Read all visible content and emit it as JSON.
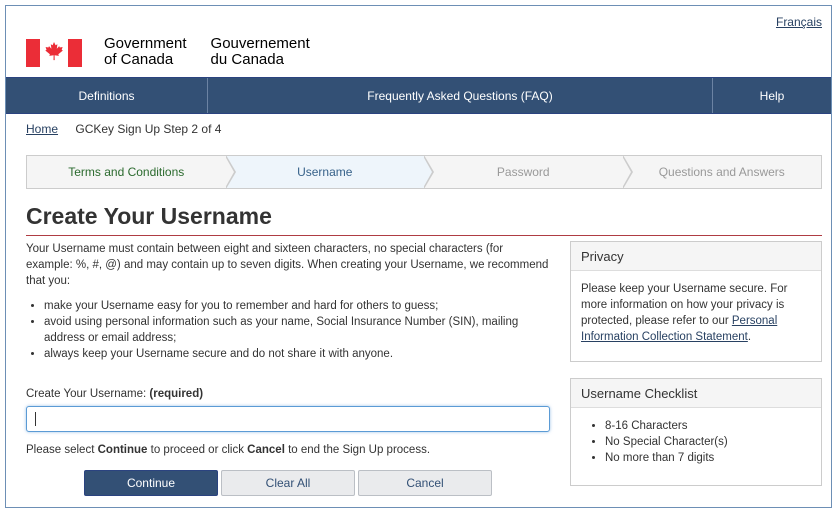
{
  "header": {
    "language_link": "Français",
    "wordmark_en_line1": "Government",
    "wordmark_en_line2": "of Canada",
    "wordmark_fr_line1": "Gouvernement",
    "wordmark_fr_line2": "du Canada"
  },
  "nav": {
    "items": [
      {
        "label": "Definitions"
      },
      {
        "label": "Frequently Asked Questions (FAQ)"
      },
      {
        "label": "Help"
      }
    ]
  },
  "breadcrumb": {
    "home": "Home",
    "current": "GCKey Sign Up Step 2 of 4"
  },
  "steps": [
    {
      "label": "Terms and Conditions",
      "state": "done"
    },
    {
      "label": "Username",
      "state": "active"
    },
    {
      "label": "Password",
      "state": "pending"
    },
    {
      "label": "Questions and Answers",
      "state": "pending"
    }
  ],
  "page": {
    "title": "Create Your Username",
    "intro": "Your Username must contain between eight and sixteen characters, no special characters (for example: %, #, @) and may contain up to seven digits. When creating your Username, we recommend that you:",
    "tips": [
      "make your Username easy for you to remember and hard for others to guess;",
      "avoid using personal information such as your name, Social Insurance Number (SIN), mailing address or email address;",
      "always keep your Username secure and do not share it with anyone."
    ]
  },
  "privacy_panel": {
    "title": "Privacy",
    "text": "Please keep your Username secure. For more information on how your privacy is protected, please refer to our",
    "link": "Personal Information Collection Statement",
    "after_link": "."
  },
  "checklist_panel": {
    "title": "Username Checklist",
    "items": [
      "8-16 Characters",
      "No Special Character(s)",
      "No more than 7 digits"
    ]
  },
  "form": {
    "label": "Create Your Username:",
    "required": "(required)",
    "value": "",
    "instruction_pre": "Please select",
    "instruction_continue": "Continue",
    "instruction_mid": "to proceed or click",
    "instruction_cancel": "Cancel",
    "instruction_post": "to end the Sign Up process."
  },
  "buttons": {
    "continue": "Continue",
    "clear_all": "Clear All",
    "cancel": "Cancel"
  },
  "colors": {
    "nav_bg": "#335075",
    "accent_rule": "#af3c43",
    "flag_red": "#eb2d37",
    "link": "#284162"
  }
}
